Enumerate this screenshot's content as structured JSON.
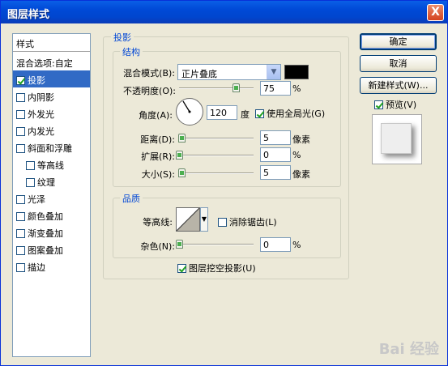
{
  "window": {
    "title": "图层样式",
    "close_label": "X"
  },
  "left_panel": {
    "header": "样式",
    "items": [
      {
        "label": "混合选项:自定",
        "checkbox": false
      },
      {
        "label": "投影",
        "checkbox": true,
        "checked": true,
        "selected": true
      },
      {
        "label": "内阴影",
        "checkbox": true,
        "checked": false
      },
      {
        "label": "外发光",
        "checkbox": true,
        "checked": false
      },
      {
        "label": "内发光",
        "checkbox": true,
        "checked": false
      },
      {
        "label": "斜面和浮雕",
        "checkbox": true,
        "checked": false
      },
      {
        "label": "等高线",
        "checkbox": true,
        "checked": false,
        "indent": true
      },
      {
        "label": "纹理",
        "checkbox": true,
        "checked": false,
        "indent": true
      },
      {
        "label": "光泽",
        "checkbox": true,
        "checked": false
      },
      {
        "label": "颜色叠加",
        "checkbox": true,
        "checked": false
      },
      {
        "label": "渐变叠加",
        "checkbox": true,
        "checked": false
      },
      {
        "label": "图案叠加",
        "checkbox": true,
        "checked": false
      },
      {
        "label": "描边",
        "checkbox": true,
        "checked": false
      }
    ]
  },
  "drop_shadow": {
    "group_title": "投影",
    "structure": {
      "group_title": "结构",
      "blend_mode_label": "混合模式(B):",
      "blend_mode_value": "正片叠底",
      "blend_color": "#000000",
      "opacity_label": "不透明度(O):",
      "opacity_value": "75",
      "opacity_unit": "%",
      "angle_label": "角度(A):",
      "angle_value": "120",
      "angle_unit": "度",
      "global_light_label": "使用全局光(G)",
      "global_light_checked": true,
      "distance_label": "距离(D):",
      "distance_value": "5",
      "distance_unit": "像素",
      "spread_label": "扩展(R):",
      "spread_value": "0",
      "spread_unit": "%",
      "size_label": "大小(S):",
      "size_value": "5",
      "size_unit": "像素"
    },
    "quality": {
      "group_title": "品质",
      "contour_label": "等高线:",
      "antialias_label": "消除锯齿(L)",
      "antialias_checked": false,
      "noise_label": "杂色(N):",
      "noise_value": "0",
      "noise_unit": "%"
    },
    "knockout_label": "图层挖空投影(U)",
    "knockout_checked": true
  },
  "buttons": {
    "ok": "确定",
    "cancel": "取消",
    "new_style": "新建样式(W)...",
    "preview_label": "预览(V)",
    "preview_checked": true
  },
  "watermark": "Bai 经验"
}
